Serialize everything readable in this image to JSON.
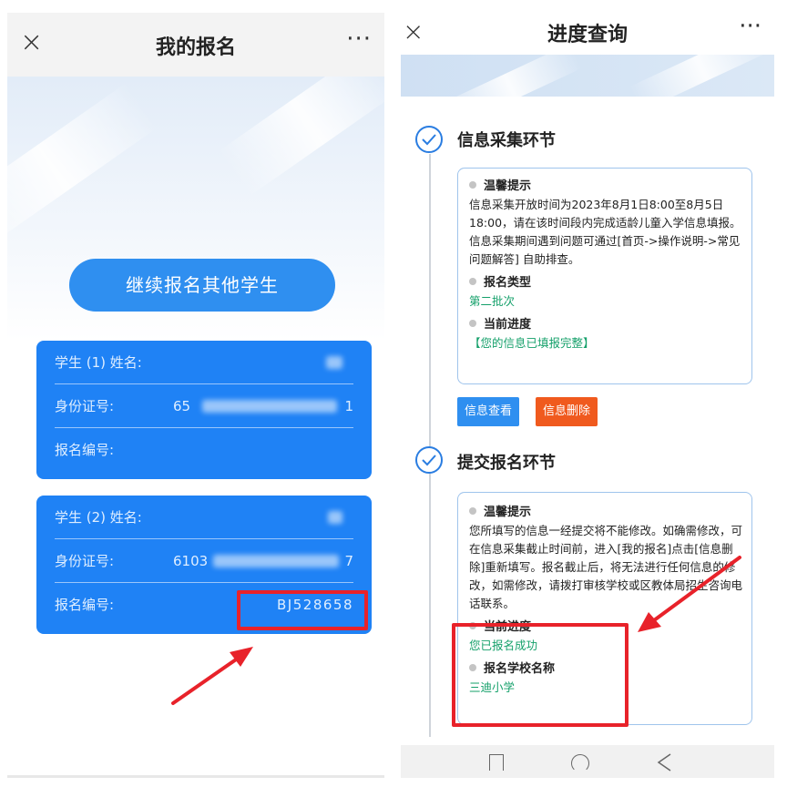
{
  "left_screen": {
    "title": "我的报名",
    "close_icon": "close-icon",
    "more_icon": "more-icon",
    "close_glyph": "×",
    "more_glyph": "···",
    "continue_button": "继续报名其他学生",
    "students": [
      {
        "name_label": "学生 (1) 姓名:",
        "id_label": "身份证号:",
        "id_value_prefix": "65",
        "id_value_suffix": "1",
        "reg_label": "报名编号:",
        "reg_value": ""
      },
      {
        "name_label": "学生 (2) 姓名:",
        "id_label": "身份证号:",
        "id_value_prefix": "6103",
        "id_value_suffix": "7",
        "reg_label": "报名编号:",
        "reg_value": "BJ528658"
      }
    ]
  },
  "right_screen": {
    "title": "进度查询",
    "close_glyph": "×",
    "more_glyph": "···",
    "steps": [
      {
        "title": "信息采集环节",
        "tip_label": "温馨提示",
        "tip_text": "信息采集开放时间为2023年8月1日8:00至8月5日18:00，请在该时间段内完成适龄儿童入学信息填报。信息采集期间遇到问题可通过[首页->操作说明->常见问题解答] 自助排查。",
        "type_label": "报名类型",
        "type_value": "第二批次",
        "progress_label": "当前进度",
        "progress_value": "【您的信息已填报完整】",
        "buttons": [
          "信息查看",
          "信息删除"
        ]
      },
      {
        "title": "提交报名环节",
        "tip_label": "温馨提示",
        "tip_text": "您所填写的信息一经提交将不能修改。如确需修改，可在信息采集截止时间前，进入[我的报名]点击[信息删除]重新填写。报名截止后，将无法进行任何信息的修改，如需修改，请拨打审核学校或区教体局招生咨询电话联系。",
        "progress_label": "当前进度",
        "progress_value": "您已报名成功",
        "school_label": "报名学校名称",
        "school_value": "三迪小学"
      }
    ]
  },
  "colors": {
    "primary_blue": "#2f8ff0",
    "card_blue": "#1f82f5",
    "delete_orange": "#f05a1e",
    "status_green": "#14a06a",
    "annotation_red": "#e8222a"
  }
}
